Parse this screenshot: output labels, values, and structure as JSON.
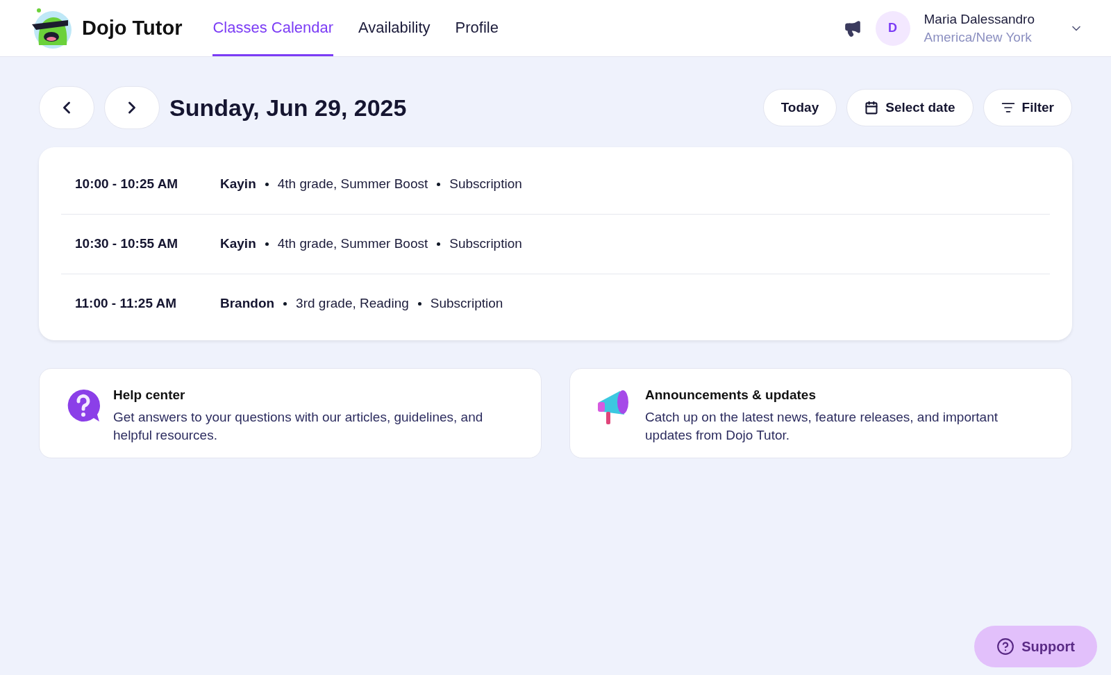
{
  "header": {
    "brand": "Dojo Tutor",
    "nav": [
      {
        "label": "Classes Calendar",
        "selected": true
      },
      {
        "label": "Availability",
        "selected": false
      },
      {
        "label": "Profile",
        "selected": false
      }
    ],
    "user": {
      "initial": "D",
      "name": "Maria Dalessandro",
      "timezone": "America/New York"
    }
  },
  "date_bar": {
    "title": "Sunday, Jun 29, 2025",
    "buttons": [
      {
        "kind": "today",
        "label": "Today"
      },
      {
        "kind": "date",
        "label": "Select date"
      },
      {
        "kind": "filter",
        "label": "Filter"
      }
    ]
  },
  "classes": [
    {
      "time": "10:00 - 10:25 AM",
      "student": "Kayin",
      "course": "4th grade, Summer Boost",
      "plan": "Subscription"
    },
    {
      "time": "10:30 - 10:55 AM",
      "student": "Kayin",
      "course": "4th grade, Summer Boost",
      "plan": "Subscription"
    },
    {
      "time": "11:00 - 11:25 AM",
      "student": "Brandon",
      "course": "3rd grade, Reading",
      "plan": "Subscription"
    }
  ],
  "resources": [
    {
      "kind": "help",
      "title": "Help center",
      "text": "Get answers to your questions with our articles, guidelines, and helpful resources."
    },
    {
      "kind": "news",
      "title": "Announcements & updates",
      "text": "Catch up on the latest news, feature releases, and important updates from Dojo Tutor."
    }
  ],
  "support": {
    "label": "Support"
  }
}
